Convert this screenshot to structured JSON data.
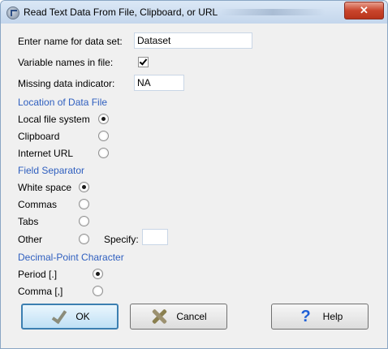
{
  "window": {
    "title": "Read Text Data From File, Clipboard, or URL",
    "close_label": "✕"
  },
  "fields": {
    "dataset_name_label": "Enter name for data set:",
    "dataset_name_value": "Dataset",
    "variable_names_label": "Variable names in file:",
    "variable_names_checked": true,
    "missing_label": "Missing data indicator:",
    "missing_value": "NA"
  },
  "location": {
    "heading": "Location of Data File",
    "options": [
      "Local file system",
      "Clipboard",
      "Internet URL"
    ],
    "selected": "Local file system"
  },
  "separator": {
    "heading": "Field Separator",
    "options": [
      "White space",
      "Commas",
      "Tabs",
      "Other"
    ],
    "selected": "White space",
    "specify_label": "Specify:",
    "specify_value": ""
  },
  "decimal": {
    "heading": "Decimal-Point Character",
    "options": [
      "Period [.]",
      "Comma [,]"
    ],
    "selected": "Period [.]"
  },
  "buttons": {
    "ok": "OK",
    "cancel": "Cancel",
    "help": "Help"
  },
  "icons": {
    "app": "r-logo-icon",
    "ok": "checkmark-icon",
    "cancel": "x-icon",
    "help": "question-mark-icon"
  },
  "colors": {
    "section_heading": "#2f5fbf",
    "titlebar": "#c4d6ec",
    "close_button": "#c9452c",
    "default_button_border": "#3c7fb1"
  }
}
